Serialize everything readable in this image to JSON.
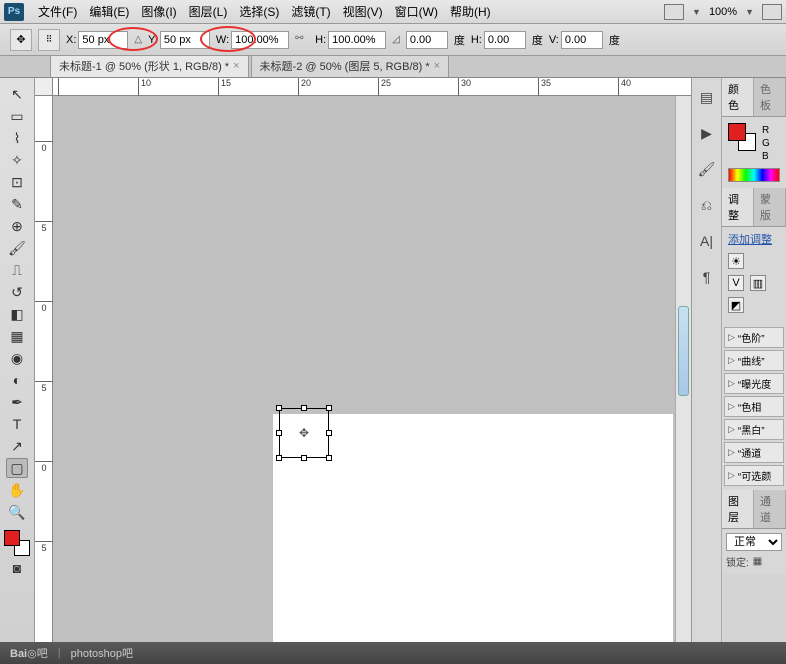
{
  "menubar": {
    "items": [
      "文件(F)",
      "编辑(E)",
      "图像(I)",
      "图层(L)",
      "选择(S)",
      "滤镜(T)",
      "视图(V)",
      "窗口(W)",
      "帮助(H)"
    ],
    "zoom": "100%"
  },
  "options": {
    "x_label": "X:",
    "x_value": "50 px",
    "y_label": "Y:",
    "y_value": "50 px",
    "w_label": "W:",
    "w_value": "100.00%",
    "h_label": "H:",
    "h_value": "100.00%",
    "angle_value": "0.00",
    "angle_unit": "度",
    "hskew_label": "H:",
    "hskew_value": "0.00",
    "hskew_unit": "度",
    "vskew_label": "V:",
    "vskew_value": "0.00",
    "vskew_unit": "度"
  },
  "tabs": [
    {
      "label": "未标题-1 @ 50% (形状 1, RGB/8) *",
      "active": true
    },
    {
      "label": "未标题-2 @ 50% (图层 5, RGB/8) *",
      "active": false
    }
  ],
  "ruler_h": [
    {
      "p": 5,
      "l": ""
    },
    {
      "p": 85,
      "l": "10"
    },
    {
      "p": 165,
      "l": "15"
    },
    {
      "p": 245,
      "l": "20"
    },
    {
      "p": 325,
      "l": "25"
    },
    {
      "p": 405,
      "l": "30"
    },
    {
      "p": 485,
      "l": "35"
    },
    {
      "p": 565,
      "l": "40"
    }
  ],
  "ruler_v": [
    {
      "p": 45,
      "l": "0"
    },
    {
      "p": 125,
      "l": "5"
    },
    {
      "p": 205,
      "l": "0"
    },
    {
      "p": 285,
      "l": "5"
    },
    {
      "p": 365,
      "l": "0"
    },
    {
      "p": 445,
      "l": "5"
    }
  ],
  "panels": {
    "color_tab": "颜色",
    "color_tab2": "色板",
    "rgb": {
      "r": "R",
      "g": "G",
      "b": "B"
    },
    "adjust_tab": "调整",
    "adjust_tab2": "蒙版",
    "adjust_link": "添加调整",
    "presets": [
      "“色阶”",
      "“曲线”",
      "“曝光度",
      "“色相",
      "“黑白”",
      "“通道",
      "“可选颜"
    ],
    "layers_tab": "图层",
    "layers_tab2": "通道",
    "blend_mode": "正常",
    "lock_label": "锁定:"
  },
  "statusbar": {
    "brand": "Bai",
    "brand2": "吧",
    "text": "photoshop吧"
  },
  "colors": {
    "fg": "#e02020",
    "bg": "#ffffff"
  }
}
